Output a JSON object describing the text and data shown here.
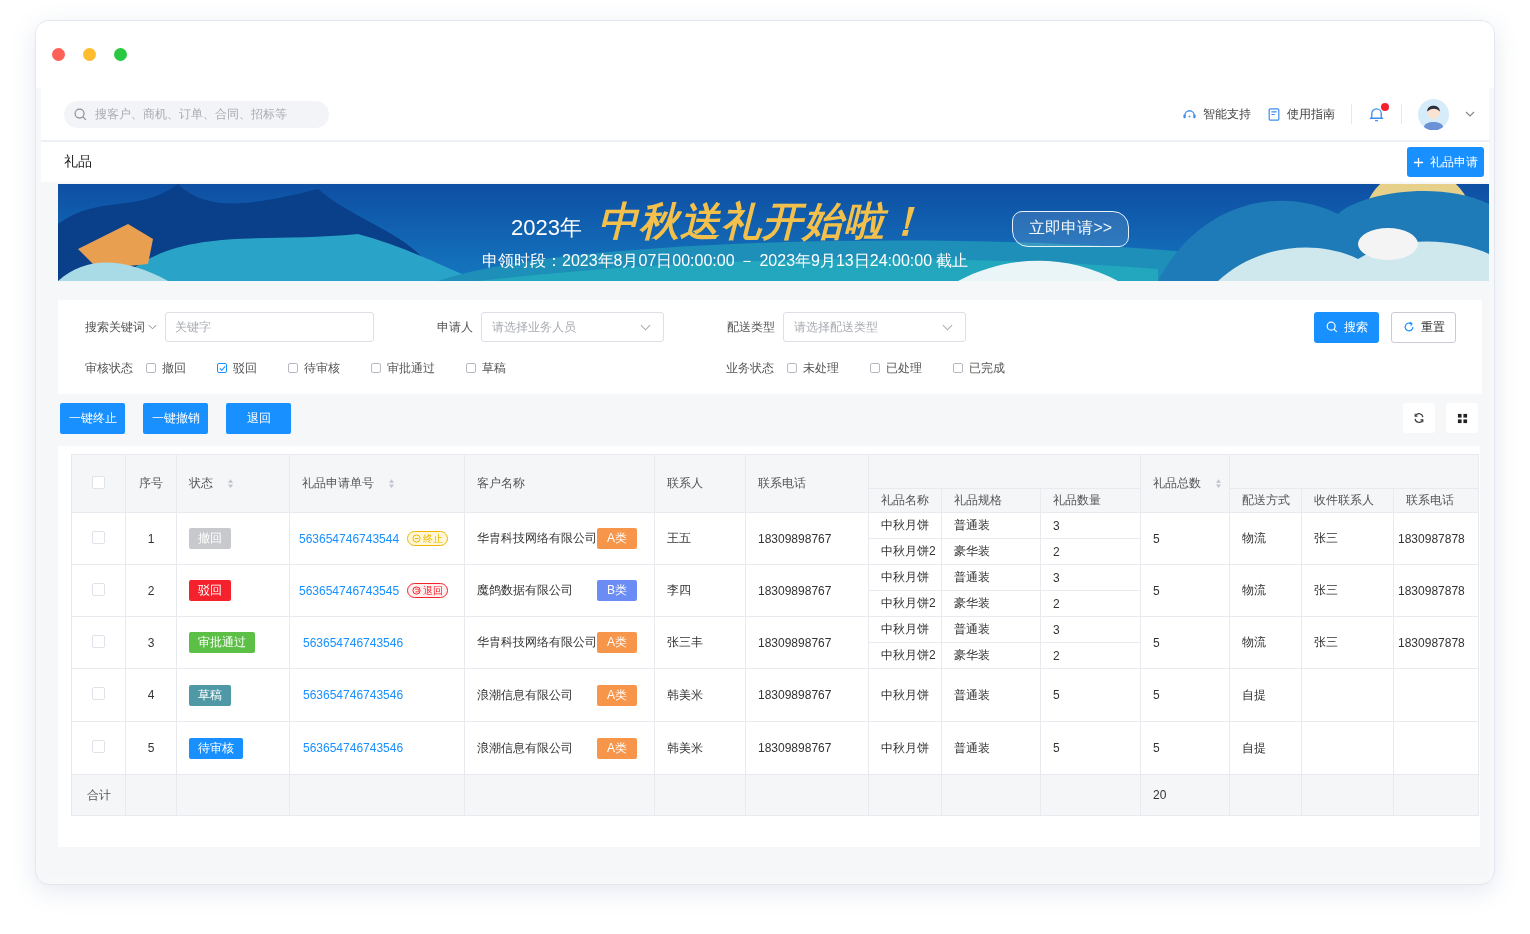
{
  "header": {
    "search": {
      "placeholder": "搜客户、商机、订单、合同、招标等"
    },
    "links": [
      {
        "label": "智能支持",
        "kind": "support"
      },
      {
        "label": "使用指南",
        "kind": "guide"
      }
    ],
    "notification_badge": true
  },
  "page": {
    "title": "礼品",
    "primary_button": "礼品申请"
  },
  "banner": {
    "year": "2023年",
    "headline": "中秋送礼开始啦！",
    "period": "申领时段：2023年8月07日00:00:00 － 2023年9月13日24:00:00 截止",
    "button": "立即申请>>"
  },
  "filters": {
    "keyword": {
      "label": "搜索关键词",
      "placeholder": "关键字"
    },
    "applicant": {
      "label": "申请人",
      "placeholder": "请选择业务人员"
    },
    "delivery_type": {
      "label": "配送类型",
      "placeholder": "请选择配送类型"
    },
    "search_button": "搜索",
    "reset_button": "重置",
    "review_status": {
      "label": "审核状态",
      "options": [
        {
          "label": "撤回",
          "checked": false
        },
        {
          "label": "驳回",
          "checked": true
        },
        {
          "label": "待审核",
          "checked": false
        },
        {
          "label": "审批通过",
          "checked": false
        },
        {
          "label": "草稿",
          "checked": false
        }
      ]
    },
    "business_status": {
      "label": "业务状态",
      "options": [
        {
          "label": "未处理",
          "checked": false
        },
        {
          "label": "已处理",
          "checked": false
        },
        {
          "label": "已完成",
          "checked": false
        }
      ]
    }
  },
  "actions": [
    "一键终止",
    "一键撤销",
    "退回"
  ],
  "table": {
    "select_all": {
      "checked": false
    },
    "columns": [
      {
        "label": "序号",
        "sortable": false
      },
      {
        "label": "状态",
        "sortable": true
      },
      {
        "label": "礼品申请单号",
        "sortable": true
      },
      {
        "label": "客户名称",
        "sortable": false
      },
      {
        "label": "联系人",
        "sortable": false
      },
      {
        "label": "联系电话",
        "sortable": false
      },
      {
        "children": [
          {
            "label": "礼品名称"
          },
          {
            "label": "礼品规格"
          },
          {
            "label": "礼品数量"
          }
        ]
      },
      {
        "label": "礼品总数",
        "sortable": true
      },
      {
        "children": [
          {
            "label": "配送方式"
          },
          {
            "label": "收件联系人"
          },
          {
            "label": "联系电话"
          }
        ]
      }
    ],
    "rows": [
      {
        "checked": false,
        "seq": "1",
        "status": {
          "label": "撤回",
          "color": "#c8c9cc"
        },
        "order_no": "563654746743544",
        "order_tag": {
          "label": "终止",
          "kind": "terminated"
        },
        "customer": "华胄科技网络有限公司",
        "customer_class": {
          "label": "A类",
          "color": "#f7954a"
        },
        "contact": "王五",
        "phone": "18309898767",
        "gifts": [
          {
            "name": "中秋月饼",
            "spec": "普通装",
            "qty": "3"
          },
          {
            "name": "中秋月饼2",
            "spec": "豪华装",
            "qty": "2"
          }
        ],
        "total": "5",
        "delivery": "物流",
        "receiver": "张三",
        "receiver_phone": "1830987878"
      },
      {
        "checked": false,
        "seq": "2",
        "status": {
          "label": "驳回",
          "color": "#f5222d"
        },
        "order_no": "563654746743545",
        "order_tag": {
          "label": "退回",
          "kind": "returned"
        },
        "customer": "魔鸽数据有限公司",
        "customer_class": {
          "label": "B类",
          "color": "#6c8cf5"
        },
        "contact": "李四",
        "phone": "18309898767",
        "gifts": [
          {
            "name": "中秋月饼",
            "spec": "普通装",
            "qty": "3"
          },
          {
            "name": "中秋月饼2",
            "spec": "豪华装",
            "qty": "2"
          }
        ],
        "total": "5",
        "delivery": "物流",
        "receiver": "张三",
        "receiver_phone": "1830987878"
      },
      {
        "checked": false,
        "seq": "3",
        "status": {
          "label": "审批通过",
          "color": "#5cbf46"
        },
        "order_no": "563654746743546",
        "customer": "华胄科技网络有限公司",
        "customer_class": {
          "label": "A类",
          "color": "#f7954a"
        },
        "contact": "张三丰",
        "phone": "18309898767",
        "gifts": [
          {
            "name": "中秋月饼",
            "spec": "普通装",
            "qty": "3"
          },
          {
            "name": "中秋月饼2",
            "spec": "豪华装",
            "qty": "2"
          }
        ],
        "total": "5",
        "delivery": "物流",
        "receiver": "张三",
        "receiver_phone": "1830987878"
      },
      {
        "checked": false,
        "seq": "4",
        "status": {
          "label": "草稿",
          "color": "#4f98a6"
        },
        "order_no": "563654746743546",
        "customer": "浪潮信息有限公司",
        "customer_class": {
          "label": "A类",
          "color": "#f7954a"
        },
        "contact": "韩美米",
        "phone": "18309898767",
        "gifts": [
          {
            "name": "中秋月饼",
            "spec": "普通装",
            "qty": "5"
          }
        ],
        "total": "5",
        "delivery": "自提"
      },
      {
        "checked": false,
        "seq": "5",
        "status": {
          "label": "待审核",
          "color": "#1890ff"
        },
        "order_no": "563654746743546",
        "customer": "浪潮信息有限公司",
        "customer_class": {
          "label": "A类",
          "color": "#f7954a"
        },
        "contact": "韩美米",
        "phone": "18309898767",
        "gifts": [
          {
            "name": "中秋月饼",
            "spec": "普通装",
            "qty": "5"
          }
        ],
        "total": "5",
        "delivery": "自提"
      }
    ],
    "summary": {
      "label": "合计",
      "total": "20"
    }
  }
}
